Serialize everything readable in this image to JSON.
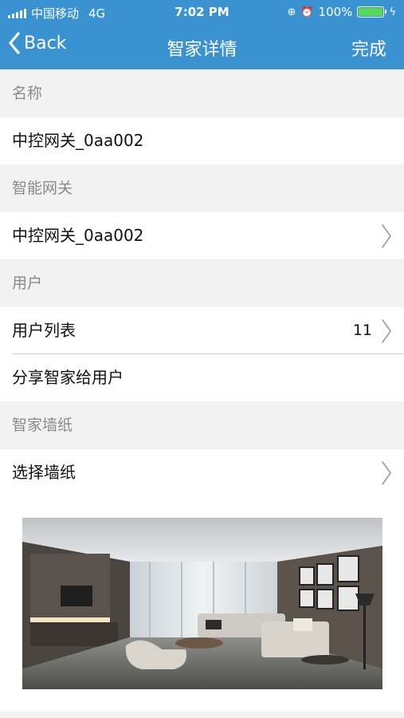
{
  "status_bar": {
    "carrier": "中国移动",
    "network": "4G",
    "time": "7:02 PM",
    "battery": "100%",
    "battery_level": 1.0,
    "icons": [
      "signal-icon",
      "rotation-lock-icon",
      "alarm-icon",
      "battery-icon",
      "charging-icon"
    ]
  },
  "nav": {
    "back_label": "Back",
    "title": "智家详情",
    "done_label": "完成"
  },
  "sections": {
    "name": {
      "header": "名称",
      "value": "中控网关_0aa002"
    },
    "gateway": {
      "header": "智能网关",
      "value": "中控网关_0aa002"
    },
    "users": {
      "header": "用户",
      "list_label": "用户列表",
      "count": "11",
      "share_label": "分享智家给用户"
    },
    "wallpaper": {
      "header": "智家墙纸",
      "select_label": "选择墙纸"
    }
  },
  "colors": {
    "nav_background": "#3a92d1",
    "page_background": "#f2f2f2",
    "row_background": "#ffffff",
    "header_text": "#8a8a8a",
    "battery_fill": "#59d861"
  }
}
